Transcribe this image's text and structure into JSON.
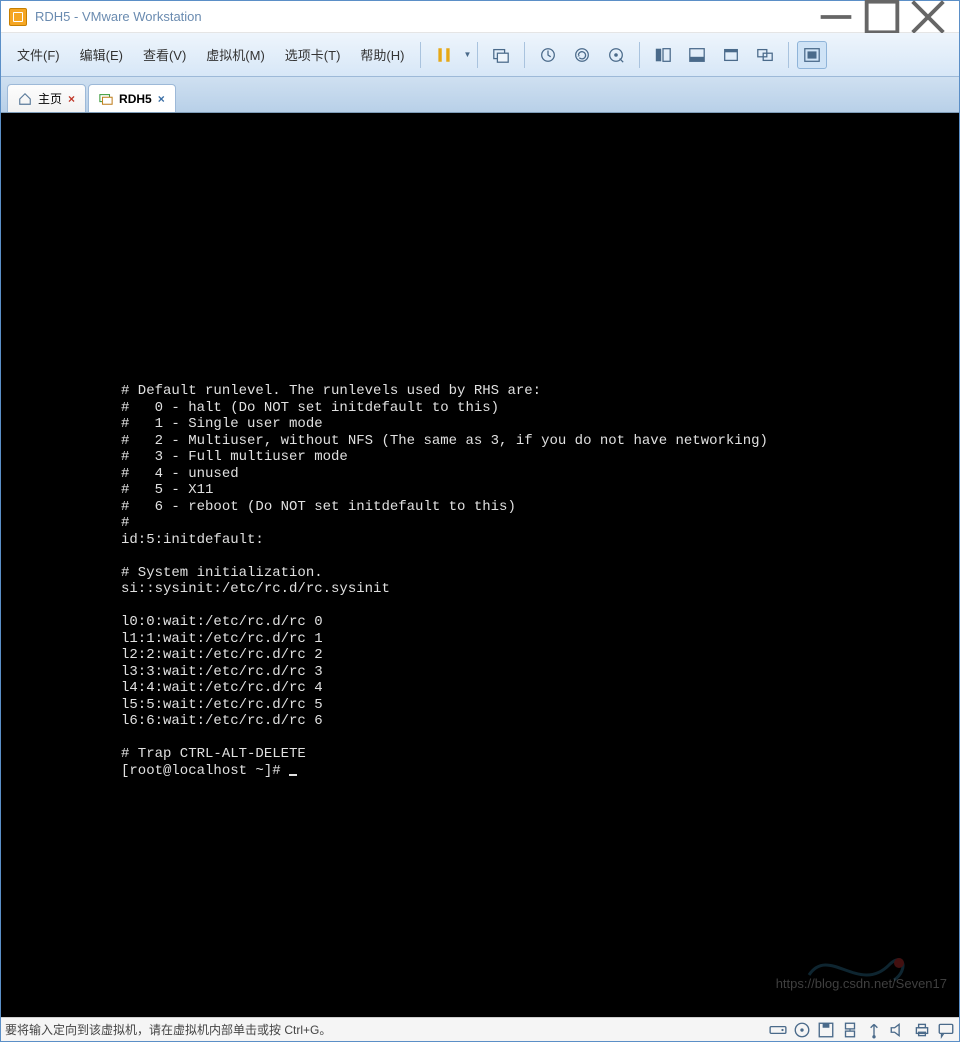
{
  "window": {
    "title": "RDH5 - VMware Workstation"
  },
  "menu": {
    "file": "文件(F)",
    "edit": "编辑(E)",
    "view": "查看(V)",
    "vm": "虚拟机(M)",
    "tabs": "选项卡(T)",
    "help": "帮助(H)"
  },
  "tabs": {
    "home": "主页",
    "vm_name": "RDH5"
  },
  "terminal": {
    "lines": [
      "# Default runlevel. The runlevels used by RHS are:",
      "#   0 - halt (Do NOT set initdefault to this)",
      "#   1 - Single user mode",
      "#   2 - Multiuser, without NFS (The same as 3, if you do not have networking)",
      "#   3 - Full multiuser mode",
      "#   4 - unused",
      "#   5 - X11",
      "#   6 - reboot (Do NOT set initdefault to this)",
      "#",
      "id:5:initdefault:",
      "",
      "# System initialization.",
      "si::sysinit:/etc/rc.d/rc.sysinit",
      "",
      "l0:0:wait:/etc/rc.d/rc 0",
      "l1:1:wait:/etc/rc.d/rc 1",
      "l2:2:wait:/etc/rc.d/rc 2",
      "l3:3:wait:/etc/rc.d/rc 3",
      "l4:4:wait:/etc/rc.d/rc 4",
      "l5:5:wait:/etc/rc.d/rc 5",
      "l6:6:wait:/etc/rc.d/rc 6",
      "",
      "# Trap CTRL-ALT-DELETE"
    ],
    "prompt": "[root@localhost ~]# "
  },
  "statusbar": {
    "message": "要将输入定向到该虚拟机，请在虚拟机内部单击或按 Ctrl+G。"
  },
  "watermark": "https://blog.csdn.net/Seven17"
}
